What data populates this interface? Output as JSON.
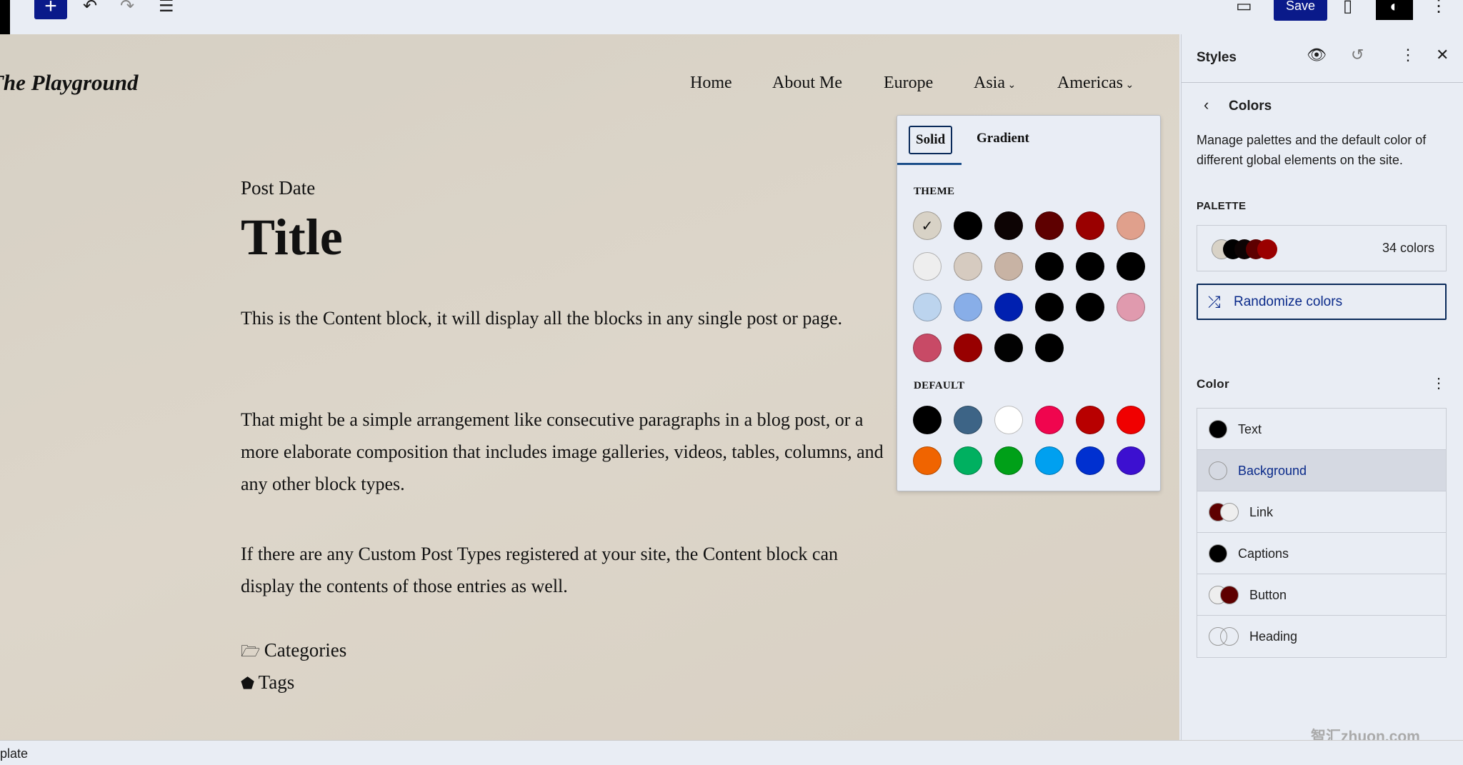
{
  "toolbar": {
    "add_icon": "plus",
    "undo_icon": "undo",
    "redo_icon": "redo",
    "outline_icon": "list-view",
    "save_label": "Save"
  },
  "canvas": {
    "site_title": "The Playground",
    "nav": [
      "Home",
      "About Me",
      "Europe",
      "Asia",
      "Americas"
    ],
    "post_date": "Post Date",
    "title": "Title",
    "paragraphs": [
      "This is the Content block, it will display all the blocks in any single post or page.",
      "That might be a simple arrangement like consecutive paragraphs in a blog post, or a more elaborate composition that includes image galleries, videos, tables, columns, and any other block types.",
      "If there are any Custom Post Types registered at your site, the Content block can display the contents of those entries as well."
    ],
    "categories": "Categories",
    "tags": "Tags"
  },
  "popover": {
    "tabs": [
      "Solid",
      "Gradient"
    ],
    "theme_label": "THEME",
    "theme_colors": [
      "#d8d2c6",
      "#000000",
      "#0d0404",
      "#5e0000",
      "#9a0000",
      "#e0a08c",
      "#eeeeee",
      "#d6cbc0",
      "#c8b3a4",
      "#000000",
      "#000000",
      "#000000",
      "#bcd4ee",
      "#88aee8",
      "#0020b0",
      "#000000",
      "#000000",
      "#e09aae",
      "#c84a66",
      "#980000",
      "#020202",
      "#000000"
    ],
    "default_label": "DEFAULT",
    "default_colors": [
      "#000000",
      "#3d6486",
      "#ffffff",
      "#f0054e",
      "#b80000",
      "#f00000",
      "#f06400",
      "#00b060",
      "#00a018",
      "#00a0f0",
      "#0030d0",
      "#3c10d0"
    ]
  },
  "sidebar": {
    "title": "Styles",
    "section": "Colors",
    "description": "Manage palettes and the default color of different global elements on the site.",
    "palette_label": "PALETTE",
    "palette_count": "34 colors",
    "randomize": "Randomize colors",
    "color_label": "Color",
    "elements": [
      {
        "label": "Text",
        "colors": [
          "#000000"
        ]
      },
      {
        "label": "Background",
        "colors": [
          "transparent"
        ]
      },
      {
        "label": "Link",
        "colors": [
          "#5e0000",
          "#eeeeee"
        ]
      },
      {
        "label": "Captions",
        "colors": [
          "#000000"
        ]
      },
      {
        "label": "Button",
        "colors": [
          "#eeeeee",
          "#5e0000"
        ]
      },
      {
        "label": "Heading",
        "colors": [
          "transparent",
          "transparent"
        ]
      }
    ]
  },
  "status": {
    "text": "plate"
  },
  "watermark": "智汇zhuon.com"
}
